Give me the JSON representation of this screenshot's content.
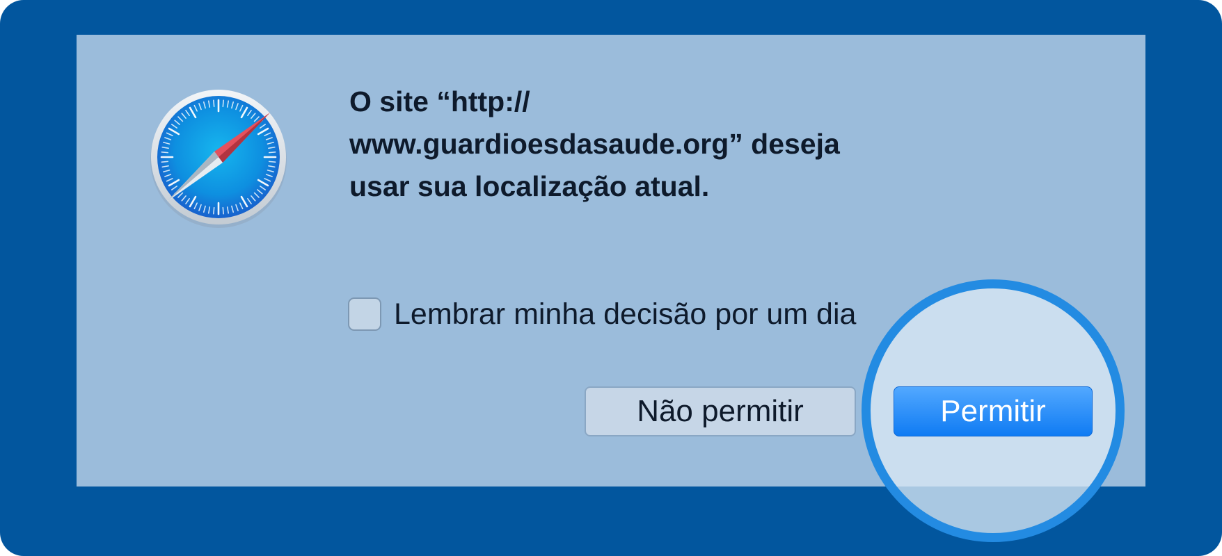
{
  "dialog": {
    "message_line1": "O site “http://",
    "message_line2": "www.guardioesdasaude.org” deseja",
    "message_line3": "usar sua localização atual.",
    "remember_label": "Lembrar minha decisão por um dia",
    "remember_checked": false,
    "deny_label": "Não permitir",
    "allow_label": "Permitir"
  },
  "icons": {
    "app_icon": "safari-compass-icon"
  },
  "colors": {
    "background": "#02569e",
    "dialog": "#9bbcdb",
    "primary_button": "#1a86f7",
    "highlight_ring": "#238be2"
  }
}
